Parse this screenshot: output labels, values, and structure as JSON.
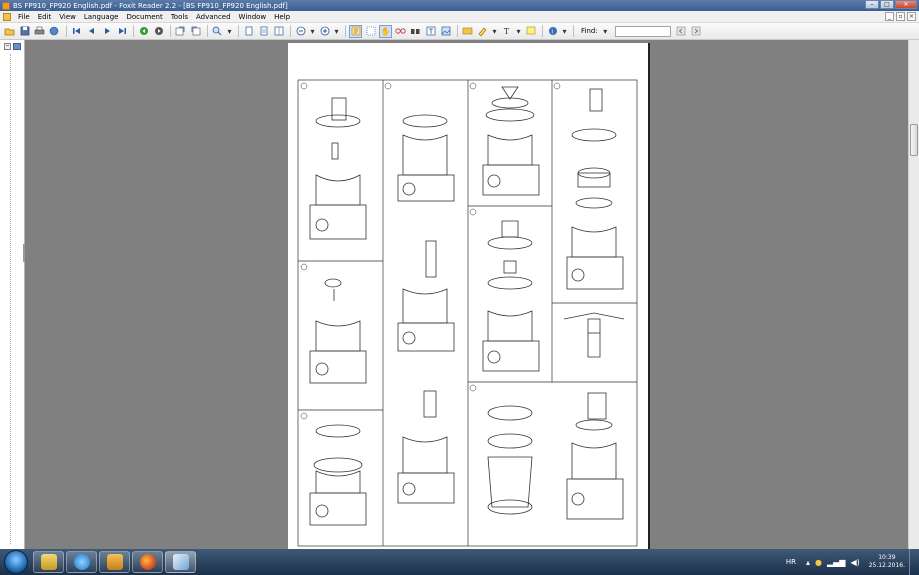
{
  "window": {
    "title": "BS FP910_FP920 English.pdf - Foxit Reader 2.2 - [BS FP910_FP920 English.pdf]",
    "buttons": {
      "minimize": "–",
      "maximize": "□",
      "close": "✕"
    }
  },
  "menubar": {
    "items": [
      "File",
      "Edit",
      "View",
      "Language",
      "Document",
      "Tools",
      "Advanced",
      "Window",
      "Help"
    ],
    "mdi": {
      "minimize": "_",
      "restore": "▫",
      "close": "×"
    }
  },
  "toolbar": {
    "find_label": "Find:",
    "find_value": "",
    "icons": [
      "open-icon",
      "save-icon",
      "print-icon",
      "email-icon",
      "first-page-icon",
      "prev-page-icon",
      "next-page-icon",
      "last-page-icon",
      "go-back-icon",
      "go-forward-icon",
      "rotate-left-icon",
      "rotate-right-icon",
      "zoom-icon",
      "single-page-icon",
      "continuous-icon",
      "facing-icon",
      "zoom-out-icon",
      "zoom-in-icon",
      "select-text-icon",
      "select-graphic-icon",
      "hand-tool-icon",
      "snapshot-icon",
      "find-icon",
      "text-viewer-icon",
      "image-icon",
      "typewriter-icon",
      "highlight-icon",
      "text-tool-icon",
      "note-icon",
      "help-icon"
    ]
  },
  "document": {
    "page_description": "manual illustration page",
    "colors": {
      "page": "#ffffff",
      "background": "#808080",
      "line": "#333333"
    }
  },
  "taskbar": {
    "apps": [
      "explorer",
      "internet-explorer",
      "folder",
      "firefox",
      "foxit"
    ],
    "tray": {
      "language": "HR",
      "time": "10:39",
      "date": "25.12.2016."
    }
  }
}
